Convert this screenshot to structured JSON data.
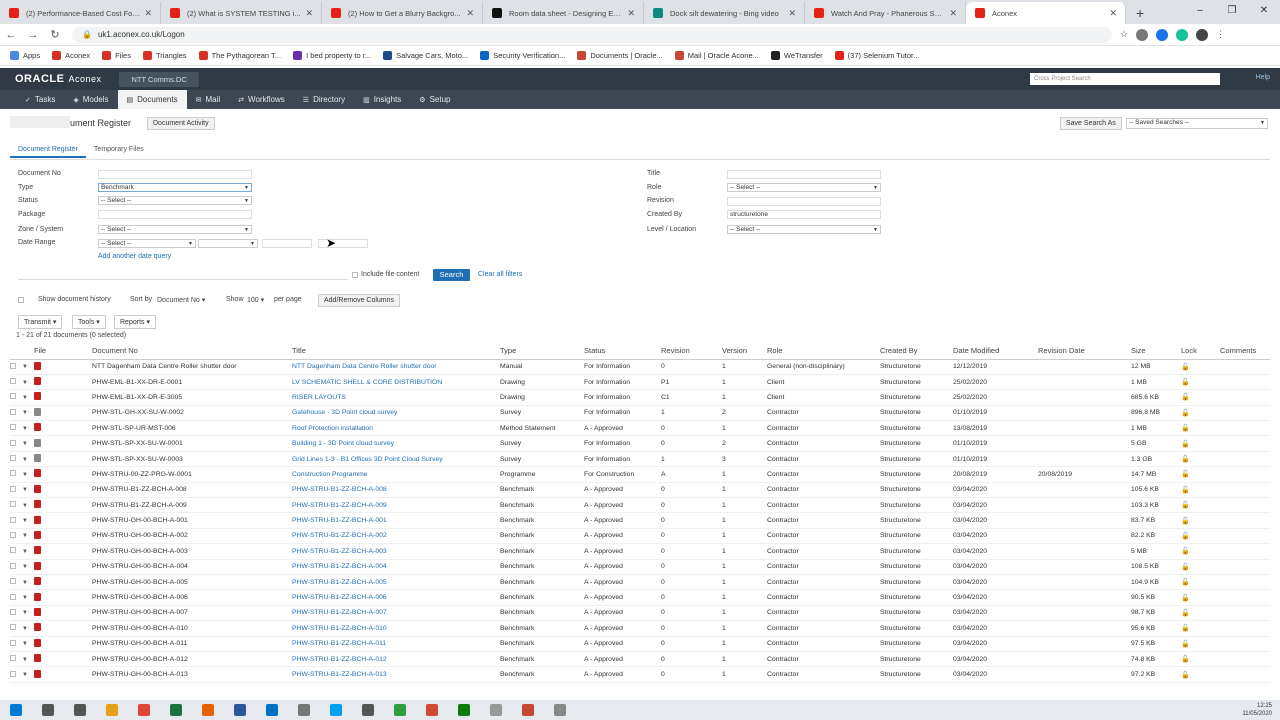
{
  "browser": {
    "tabs": [
      {
        "title": "(2) Performance-Based Cost For...",
        "color": "#e62117"
      },
      {
        "title": "(2) What is SYSTEM TESTING i...",
        "color": "#e62117"
      },
      {
        "title": "(2) How to Get a Blurry Backgro...",
        "color": "#e62117"
      },
      {
        "title": "Room data sheet - Designing En...",
        "color": "#111111"
      },
      {
        "title": "Dock silt dewatering - Bing video",
        "color": "#0f8a7e"
      },
      {
        "title": "Watch And Pray - Phanerous Surv...",
        "color": "#e62117"
      },
      {
        "title": "Aconex",
        "color": "#e62117"
      }
    ],
    "new_tab": "+",
    "url": "uk1.aconex.co.uk/Logon",
    "bookmarks": [
      {
        "label": "Apps",
        "color": "#4a89dc"
      },
      {
        "label": "Aconex",
        "color": "#d93025"
      },
      {
        "label": "Files",
        "color": "#d93025"
      },
      {
        "label": "Triangles",
        "color": "#d93025"
      },
      {
        "label": "The Pythagorean T...",
        "color": "#d93025"
      },
      {
        "label": "I bed property to r...",
        "color": "#6b2fa8"
      },
      {
        "label": "Salvage Cars, Moto...",
        "color": "#1a4b8c"
      },
      {
        "label": "Security Verification...",
        "color": "#0a66c2"
      },
      {
        "label": "Documents | Oracle...",
        "color": "#c74634"
      },
      {
        "label": "Mail | Oracle Acone...",
        "color": "#c74634"
      },
      {
        "label": "WeTransfer",
        "color": "#222222"
      },
      {
        "label": "(37) Selenium Tutor...",
        "color": "#e62117"
      }
    ]
  },
  "app": {
    "brand": "ORACLE",
    "product": "Aconex",
    "project": "NTT Comms.DC",
    "cross_search": "Cross Project Search",
    "help": "Help",
    "nav": [
      {
        "label": "Tasks",
        "icon": "✓"
      },
      {
        "label": "Models",
        "icon": "◈"
      },
      {
        "label": "Documents",
        "icon": "▤"
      },
      {
        "label": "Mail",
        "icon": "✉"
      },
      {
        "label": "Workflows",
        "icon": "⇄"
      },
      {
        "label": "Directory",
        "icon": "☰"
      },
      {
        "label": "Insights",
        "icon": "▥"
      },
      {
        "label": "Setup",
        "icon": "⚙"
      }
    ]
  },
  "page": {
    "title": "ument Register",
    "doc_activity": "Document Activity",
    "save_search_as": "Save Search As",
    "saved_searches": "-- Saved Searches --",
    "subtabs": [
      "Document Register",
      "Temporary Files"
    ]
  },
  "filters": {
    "document_no": "Document No",
    "type": "Type",
    "type_value": "Benchmark",
    "status": "Status",
    "status_value": "-- Select --",
    "package": "Package",
    "zone": "Zone / System",
    "zone_value": "-- Select --",
    "date_range": "Date Range",
    "date_value": "-- Select --",
    "add_date": "Add another date query",
    "title": "Title",
    "role": "Role",
    "role_value": "-- Select --",
    "revision": "Revision",
    "created_by": "Created By",
    "created_by_value": "structuretone",
    "level": "Level / Location",
    "level_value": "-- Select --",
    "include_file": "Include file content",
    "search": "Search",
    "clear": "Clear all filters"
  },
  "toolbar": {
    "show_history": "Show document history",
    "sort_by": "Sort by",
    "sort_value": "Document No",
    "show": "Show",
    "show_value": "100",
    "per_page": "per page",
    "add_remove": "Add/Remove Columns",
    "transmit": "Transmit",
    "tools": "Tools",
    "reports": "Reports",
    "count": "1 - 21 of 21 documents (0 selected)"
  },
  "table": {
    "headers": [
      "File",
      "Document No",
      "Title",
      "Type",
      "Status",
      "Revision",
      "Version",
      "Role",
      "Created By",
      "Date Modified",
      "Revision Date",
      "Size",
      "Lock",
      "Comments"
    ],
    "rows": [
      {
        "file": "pdf",
        "doc": "NTT Dagenham Data Centre Roller shutter door",
        "title": "NTT Dagenham Data Centre Roller shutter door",
        "type": "Manual",
        "status": "For Information",
        "rev": "0",
        "ver": "1",
        "role": "General (non-disciplinary)",
        "by": "Structuretone",
        "mod": "12/12/2019",
        "revdate": "",
        "size": "12 MB"
      },
      {
        "file": "pdf",
        "doc": "PHW-EML-B1-XX-DR-E-0001",
        "title": "LV SCHEMATIC SHELL & CORE DISTRIBUTION",
        "type": "Drawing",
        "status": "For Information",
        "rev": "P1",
        "ver": "1",
        "role": "Client",
        "by": "Structuretone",
        "mod": "25/02/2020",
        "revdate": "",
        "size": "1 MB"
      },
      {
        "file": "pdf",
        "doc": "PHW-EML-B1-XX-DR-E-3005",
        "title": "RISER LAYOUTS",
        "type": "Drawing",
        "status": "For Information",
        "rev": "C1",
        "ver": "1",
        "role": "Client",
        "by": "Structuretone",
        "mod": "25/02/2020",
        "revdate": "",
        "size": "685.6 KB"
      },
      {
        "file": "gen",
        "doc": "PHW-STL-GH-XX-SU-W-0002",
        "title": "Gatehouse - 3D Point cloud survey",
        "type": "Survey",
        "status": "For Information",
        "rev": "1",
        "ver": "2",
        "role": "Contractor",
        "by": "Structuretone",
        "mod": "01/10/2019",
        "revdate": "",
        "size": "896.8 MB"
      },
      {
        "file": "pdf",
        "doc": "PHW-STL-SP-UR-MST-006",
        "title": "Roof Protection installation",
        "type": "Method Statement",
        "status": "A - Approved",
        "rev": "0",
        "ver": "1",
        "role": "Contractor",
        "by": "Structuretone",
        "mod": "13/08/2019",
        "revdate": "",
        "size": "1 MB"
      },
      {
        "file": "gen",
        "doc": "PHW-STL-SP-XX-SU-W-0001",
        "title": "Building 1 - 3D Point cloud survey",
        "type": "Survey",
        "status": "For Information",
        "rev": "0",
        "ver": "2",
        "role": "Contractor",
        "by": "Structuretone",
        "mod": "01/10/2019",
        "revdate": "",
        "size": "5 GB"
      },
      {
        "file": "gen",
        "doc": "PHW-STL-SP-XX-SU-W-0003",
        "title": "Grid Lines 1-3 - B1 Offices 3D Point Cloud Survey",
        "type": "Survey",
        "status": "For Information",
        "rev": "1",
        "ver": "3",
        "role": "Contractor",
        "by": "Structuretone",
        "mod": "01/10/2019",
        "revdate": "",
        "size": "1.3 GB"
      },
      {
        "file": "pdf",
        "doc": "PHW-STRU-00-ZZ-PRG-W-0001",
        "title": "Construction Programme",
        "type": "Programme",
        "status": "For Construction",
        "rev": "A",
        "ver": "1",
        "role": "Contractor",
        "by": "Structuretone",
        "mod": "20/08/2019",
        "revdate": "20/08/2019",
        "size": "14.7 MB"
      },
      {
        "file": "pdf",
        "doc": "PHW-STRU-B1-ZZ-BCH-A-008",
        "title": "PHW-STRU-B1-ZZ-BCH-A-008",
        "type": "Benchmark",
        "status": "A - Approved",
        "rev": "0",
        "ver": "1",
        "role": "Contractor",
        "by": "Structuretone",
        "mod": "03/04/2020",
        "revdate": "",
        "size": "105.6 KB"
      },
      {
        "file": "pdf",
        "doc": "PHW-STRU-B1-ZZ-BCH-A-009",
        "title": "PHW-STRU-B1-ZZ-BCH-A-009",
        "type": "Benchmark",
        "status": "A - Approved",
        "rev": "0",
        "ver": "1",
        "role": "Contractor",
        "by": "Structuretone",
        "mod": "03/04/2020",
        "revdate": "",
        "size": "103.3 KB"
      },
      {
        "file": "pdf",
        "doc": "PHW-STRU-GH-00-BCH-A-001",
        "title": "PHW-STRU-B1-ZZ-BCH-A-001",
        "type": "Benchmark",
        "status": "A - Approved",
        "rev": "0",
        "ver": "1",
        "role": "Contractor",
        "by": "Structuretone",
        "mod": "03/04/2020",
        "revdate": "",
        "size": "83.7 KB"
      },
      {
        "file": "pdf",
        "doc": "PHW-STRU-GH-00-BCH-A-002",
        "title": "PHW-STRU-B1-ZZ-BCH-A-002",
        "type": "Benchmark",
        "status": "A - Approved",
        "rev": "0",
        "ver": "1",
        "role": "Contractor",
        "by": "Structuretone",
        "mod": "03/04/2020",
        "revdate": "",
        "size": "82.2 KB"
      },
      {
        "file": "pdf",
        "doc": "PHW-STRU-GH-00-BCH-A-003",
        "title": "PHW-STRU-B1-ZZ-BCH-A-003",
        "type": "Benchmark",
        "status": "A - Approved",
        "rev": "0",
        "ver": "1",
        "role": "Contractor",
        "by": "Structuretone",
        "mod": "03/04/2020",
        "revdate": "",
        "size": "5 MB"
      },
      {
        "file": "pdf",
        "doc": "PHW-STRU-GH-00-BCH-A-004",
        "title": "PHW-STRU-B1-ZZ-BCH-A-004",
        "type": "Benchmark",
        "status": "A - Approved",
        "rev": "0",
        "ver": "1",
        "role": "Contractor",
        "by": "Structuretone",
        "mod": "03/04/2020",
        "revdate": "",
        "size": "108.5 KB"
      },
      {
        "file": "pdf",
        "doc": "PHW-STRU-GH-00-BCH-A-005",
        "title": "PHW-STRU-B1-ZZ-BCH-A-005",
        "type": "Benchmark",
        "status": "A - Approved",
        "rev": "0",
        "ver": "1",
        "role": "Contractor",
        "by": "Structuretone",
        "mod": "03/04/2020",
        "revdate": "",
        "size": "104.9 KB"
      },
      {
        "file": "pdf",
        "doc": "PHW-STRU-GH-00-BCH-A-006",
        "title": "PHW-STRU-B1-ZZ-BCH-A-006",
        "type": "Benchmark",
        "status": "A - Approved",
        "rev": "0",
        "ver": "1",
        "role": "Contractor",
        "by": "Structuretone",
        "mod": "03/04/2020",
        "revdate": "",
        "size": "90.5 KB"
      },
      {
        "file": "pdf",
        "doc": "PHW-STRU-GH-00-BCH-A-007",
        "title": "PHW-STRU-B1-ZZ-BCH-A-007",
        "type": "Benchmark",
        "status": "A - Approved",
        "rev": "0",
        "ver": "1",
        "role": "Contractor",
        "by": "Structuretone",
        "mod": "03/04/2020",
        "revdate": "",
        "size": "98.7 KB"
      },
      {
        "file": "pdf",
        "doc": "PHW-STRU-GH-00-BCH-A-010",
        "title": "PHW-STRU-B1-ZZ-BCH-A-010",
        "type": "Benchmark",
        "status": "A - Approved",
        "rev": "0",
        "ver": "1",
        "role": "Contractor",
        "by": "Structuretone",
        "mod": "03/04/2020",
        "revdate": "",
        "size": "95.6 KB"
      },
      {
        "file": "pdf",
        "doc": "PHW-STRU-GH-00-BCH-A-011",
        "title": "PHW-STRU-B1-ZZ-BCH-A-011",
        "type": "Benchmark",
        "status": "A - Approved",
        "rev": "0",
        "ver": "1",
        "role": "Contractor",
        "by": "Structuretone",
        "mod": "03/04/2020",
        "revdate": "",
        "size": "97.5 KB"
      },
      {
        "file": "pdf",
        "doc": "PHW-STRU-GH-00-BCH-A-012",
        "title": "PHW-STRU-B1-ZZ-BCH-A-012",
        "type": "Benchmark",
        "status": "A - Approved",
        "rev": "0",
        "ver": "1",
        "role": "Contractor",
        "by": "Structuretone",
        "mod": "03/04/2020",
        "revdate": "",
        "size": "74.8 KB"
      },
      {
        "file": "pdf",
        "doc": "PHW-STRU-GH-00-BCH-A-013",
        "title": "PHW-STRU-B1-ZZ-BCH-A-013",
        "type": "Benchmark",
        "status": "A - Approved",
        "rev": "0",
        "ver": "1",
        "role": "Contractor",
        "by": "Structuretone",
        "mod": "03/04/2020",
        "revdate": "",
        "size": "97.2 KB"
      }
    ]
  },
  "taskbar": {
    "apps": [
      "#0078d7",
      "#555555",
      "#555555",
      "#e3a21a",
      "#db4437",
      "#1d6f42",
      "#e66000",
      "#2b579a",
      "#0072c6",
      "#777777",
      "#00a2ed",
      "#555555",
      "#2ea043",
      "#d14836",
      "#0e7a0d",
      "#999999",
      "#c74634",
      "#888888"
    ],
    "time": "12:25",
    "date": "11/05/2020"
  }
}
